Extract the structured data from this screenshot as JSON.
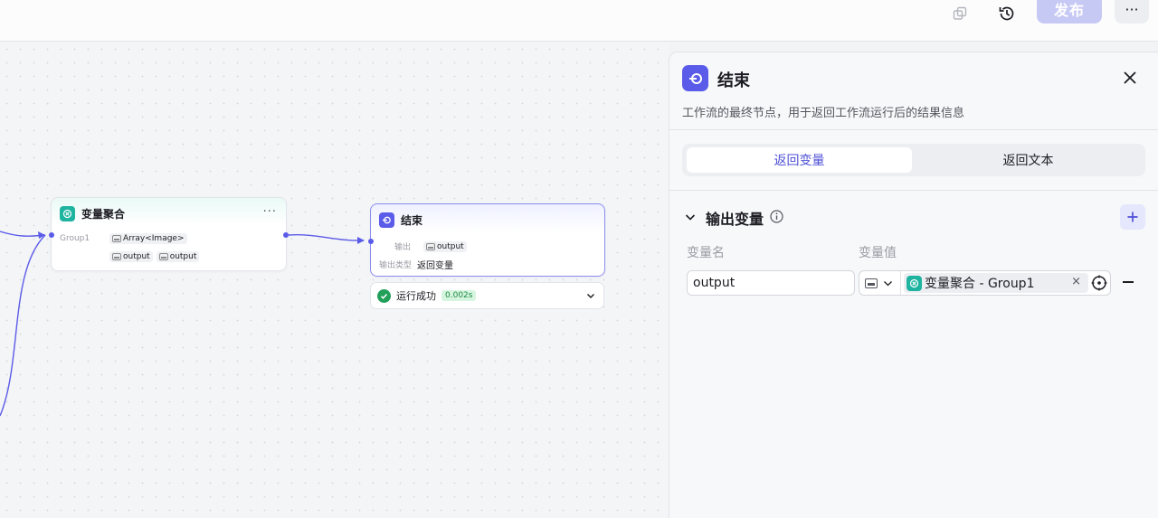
{
  "topbar": {
    "publish_label": "发布",
    "more_label": "···",
    "icons": [
      "copy-icon",
      "history-icon"
    ]
  },
  "canvas": {
    "agg_node": {
      "title": "变量聚合",
      "menu": "···",
      "group_label": "Group1",
      "group_type": "Array<Image>",
      "outputs": [
        "output",
        "output"
      ]
    },
    "end_node": {
      "title": "结束",
      "output_label": "输出",
      "output_value": "output",
      "type_label": "输出类型",
      "type_value": "返回变量"
    },
    "run": {
      "status": "运行成功",
      "time": "0.002s"
    }
  },
  "panel": {
    "title": "结束",
    "description": "工作流的最终节点，用于返回工作流运行后的结果信息",
    "tabs": [
      "返回变量",
      "返回文本"
    ],
    "active_tab": 0,
    "section_title": "输出变量",
    "col_name": "变量名",
    "col_value": "变量值",
    "var_name": "output",
    "ref_value": "变量聚合 - Group1",
    "ref_clear": "×"
  },
  "colors": {
    "accent": "#5a5be8",
    "teal": "#1fb4a0",
    "success": "#22a05a"
  }
}
